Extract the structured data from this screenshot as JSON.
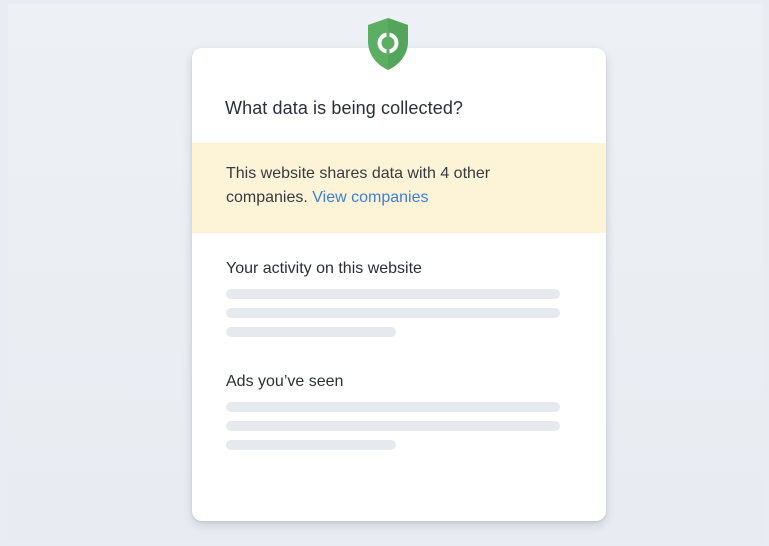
{
  "card": {
    "title": "What data is being collected?",
    "shield_icon": "shield-icon",
    "accent_color": "#5cae63",
    "notice": {
      "text": "This website shares data with 4 other companies.",
      "link_label": "View companies",
      "background": "#fdf4d8",
      "link_color": "#3d7fd6"
    },
    "sections": [
      {
        "heading": "Your activity on this website"
      },
      {
        "heading": "Ads you’ve seen"
      }
    ]
  }
}
